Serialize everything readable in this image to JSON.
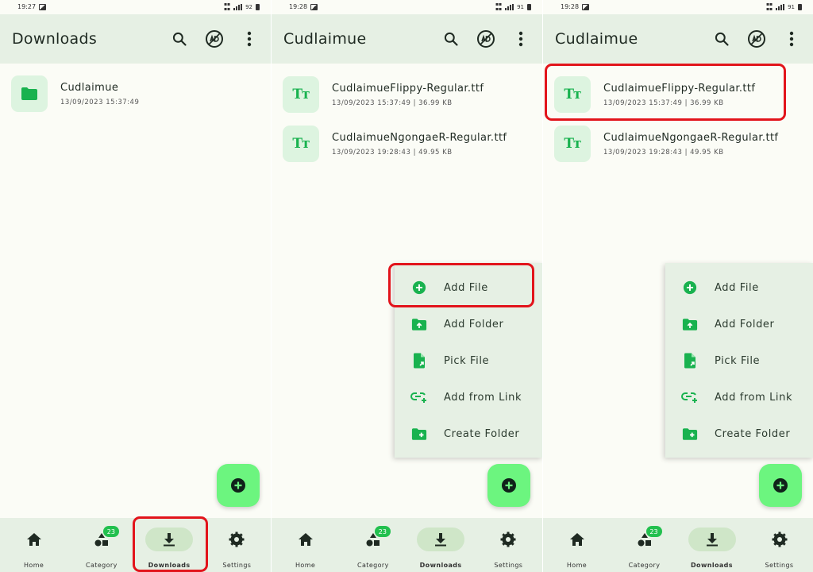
{
  "status_bars": [
    {
      "time": "19:27",
      "battery": "92"
    },
    {
      "time": "19:28",
      "battery": "91"
    },
    {
      "time": "19:28",
      "battery": "91"
    }
  ],
  "panels": [
    {
      "title": "Downloads"
    },
    {
      "title": "Cudlaimue"
    },
    {
      "title": "Cudlaimue"
    }
  ],
  "folder_list": [
    {
      "name": "Cudlaimue",
      "meta": "13/09/2023 15:37:49"
    }
  ],
  "file_list": [
    {
      "name": "CudlaimueFlippy-Regular.ttf",
      "meta": "13/09/2023 15:37:49 | 36.99 KB"
    },
    {
      "name": "CudlaimueNgongaeR-Regular.ttf",
      "meta": "13/09/2023 19:28:43 | 49.95 KB"
    }
  ],
  "fab_menu": [
    {
      "label": "Add File",
      "icon": "add-circle-icon"
    },
    {
      "label": "Add Folder",
      "icon": "folder-upload-icon"
    },
    {
      "label": "Pick File",
      "icon": "file-pick-icon"
    },
    {
      "label": "Add from Link",
      "icon": "link-add-icon"
    },
    {
      "label": "Create Folder",
      "icon": "folder-add-icon"
    }
  ],
  "nav": {
    "home": "Home",
    "category": "Category",
    "category_badge": "23",
    "downloads": "Downloads",
    "settings": "Settings"
  },
  "colors": {
    "accent": "#19b24f",
    "fab": "#6cf57f",
    "surface": "#e6f0e4",
    "highlight": "#e2141b"
  }
}
